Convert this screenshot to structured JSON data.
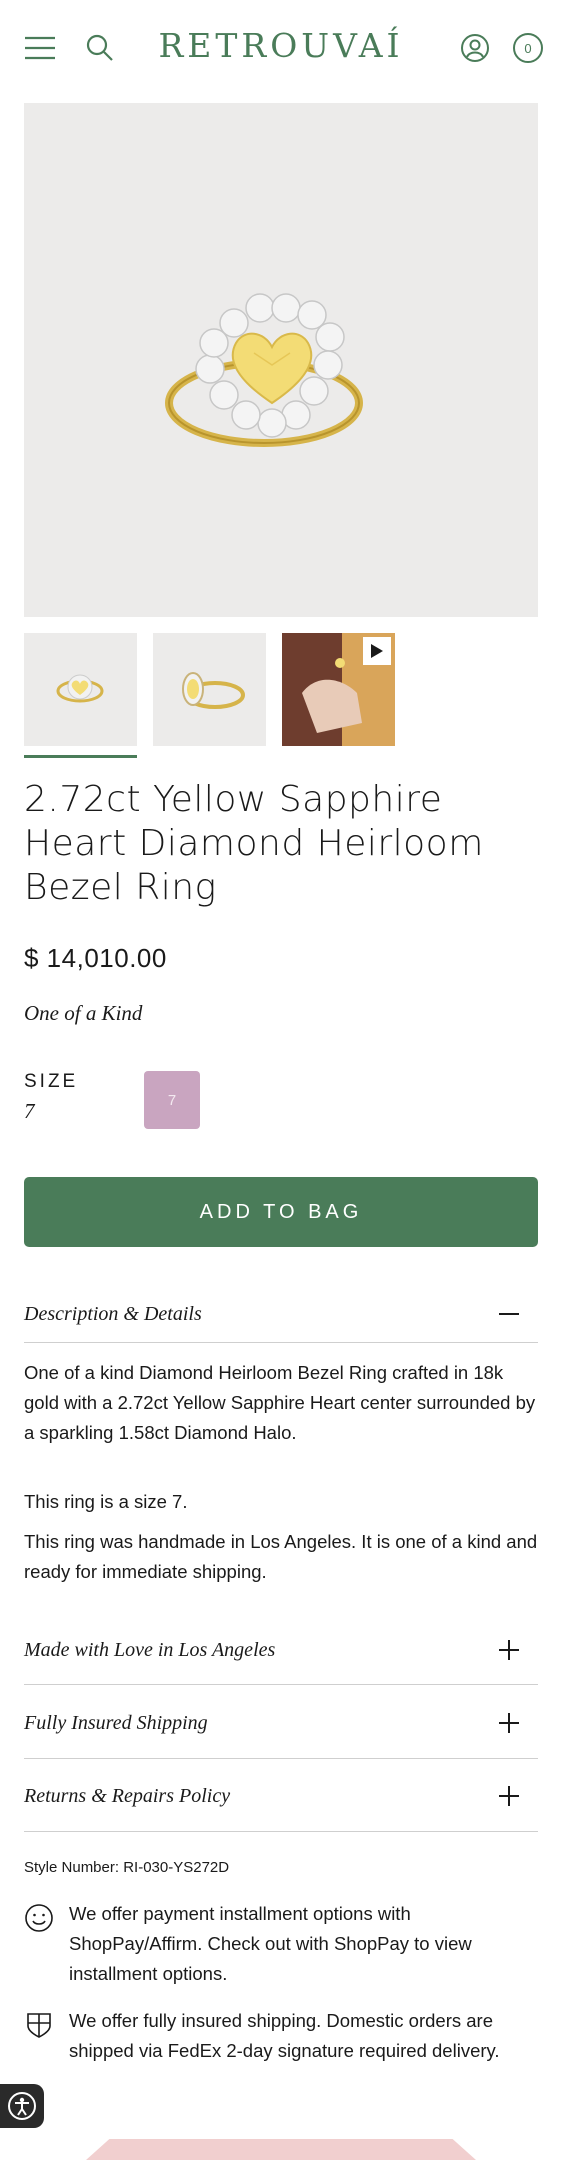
{
  "header": {
    "logo": "RETROUVAÍ",
    "cart_count": "0",
    "accent_color": "#4a7c59",
    "icons": [
      "menu-icon",
      "search-icon",
      "account-icon",
      "cart-icon"
    ]
  },
  "product": {
    "title": "2.72ct Yellow Sapphire Heart Diamond Heirloom Bezel Ring",
    "price": "$ 14,010.00",
    "availability": "One of a Kind",
    "size_label": "SIZE",
    "size_value": "7",
    "size_options": [
      "7"
    ],
    "add_to_bag": "ADD TO BAG"
  },
  "accordions": [
    {
      "title": "Description & Details",
      "expanded": true
    },
    {
      "title": "Made with Love in Los Angeles",
      "expanded": false
    },
    {
      "title": "Fully Insured Shipping",
      "expanded": false
    },
    {
      "title": "Returns & Repairs Policy",
      "expanded": false
    }
  ],
  "description": {
    "p1": "One of a kind Diamond Heirloom Bezel Ring crafted in 18k gold with a 2.72ct Yellow Sapphire Heart center surrounded by a sparkling 1.58ct Diamond Halo.",
    "p2": "This ring is a size 7.",
    "p3": "This ring was handmade in Los Angeles. It is one of a kind and ready for immediate shipping."
  },
  "style_number": "Style Number: RI-030-YS272D",
  "info": [
    {
      "icon": "smile-icon",
      "text": "We offer payment installment options with ShopPay/Affirm. Check out with ShopPay to view installment options."
    },
    {
      "icon": "shield-icon",
      "text": "We offer fully insured shipping. Domestic orders are shipped via FedEx 2-day signature required delivery."
    }
  ]
}
